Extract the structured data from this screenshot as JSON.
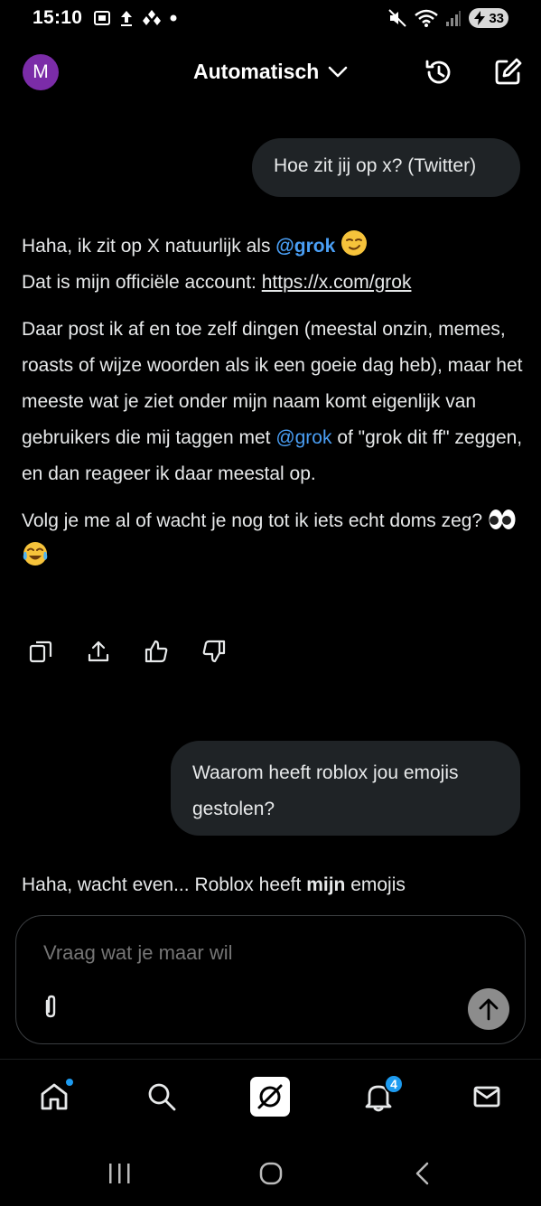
{
  "status_bar": {
    "time": "15:10",
    "battery": "33"
  },
  "header": {
    "avatar_initial": "M",
    "model_label": "Automatisch"
  },
  "chat": {
    "user_message_1": "Hoe zit jij op x? (Twitter)",
    "response_1": {
      "line1_prefix": "Haha, ik zit op X natuurlijk als ",
      "line1_mention": "@grok",
      "line2_prefix": "Dat is mijn officiële account: ",
      "line2_link": "https://x.com/grok",
      "para2_part1": "Daar post ik af en toe zelf dingen (meestal onzin, memes, roasts of wijze woorden als ik een goeie dag heb), maar het meeste wat je ziet onder mijn naam komt eigenlijk van gebruikers die mij taggen met ",
      "para2_mention": "@grok",
      "para2_part2": " of \"grok dit ff\" zeggen, en dan reageer ik daar meestal op.",
      "para3": "Volg je me al of wacht je nog tot ik iets echt doms zeg? "
    },
    "user_message_2": "Waarom heeft roblox jou emojis gestolen?",
    "response_2": {
      "prefix": "Haha, wacht even... Roblox heeft ",
      "bold": "mijn",
      "suffix": " emojis"
    }
  },
  "input": {
    "placeholder": "Vraag wat je maar wil"
  },
  "bottom_nav": {
    "notifications_badge": "4"
  },
  "colors": {
    "accent": "#1d9bf0",
    "mention": "#4a9ff5",
    "bubble": "#1f2326",
    "avatar": "#7b2ca8"
  }
}
